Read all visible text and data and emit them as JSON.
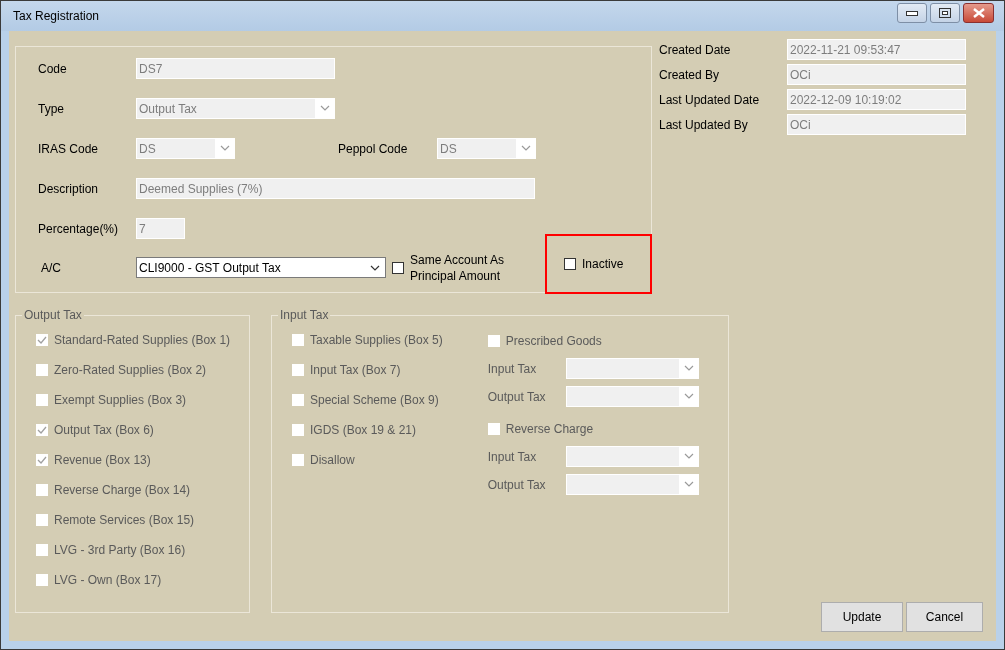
{
  "window": {
    "title": "Tax Registration"
  },
  "main_form": {
    "code": {
      "label": "Code",
      "value": "DS7",
      "disabled": true
    },
    "type": {
      "label": "Type",
      "value": "Output Tax",
      "disabled": true
    },
    "iras_code": {
      "label": "IRAS Code",
      "value": "DS",
      "disabled": true
    },
    "peppol_code": {
      "label": "Peppol Code",
      "value": "DS",
      "disabled": true
    },
    "description": {
      "label": "Description",
      "value": "Deemed Supplies (7%)",
      "disabled": true
    },
    "percentage": {
      "label": "Percentage(%)",
      "value": "7",
      "disabled": true
    },
    "account": {
      "label": "A/C",
      "value": "CLI9000 - GST Output Tax",
      "disabled": false
    },
    "same_account": {
      "label": "Same Account As Principal Amount",
      "checked": false,
      "disabled": false
    },
    "inactive": {
      "label": "Inactive",
      "checked": false,
      "disabled": false,
      "highlighted": true
    }
  },
  "audit": [
    {
      "label": "Created Date",
      "value": "2022-11-21 09:53:47"
    },
    {
      "label": "Created By",
      "value": "OCi"
    },
    {
      "label": "Last Updated Date",
      "value": "2022-12-09 10:19:02"
    },
    {
      "label": "Last Updated By",
      "value": "OCi"
    }
  ],
  "output_tax": {
    "title": "Output Tax",
    "items": [
      {
        "label": "Standard-Rated Supplies (Box 1)",
        "checked": true,
        "disabled": true
      },
      {
        "label": "Zero-Rated Supplies (Box 2)",
        "checked": false,
        "disabled": true
      },
      {
        "label": "Exempt Supplies (Box 3)",
        "checked": false,
        "disabled": true
      },
      {
        "label": "Output Tax (Box 6)",
        "checked": true,
        "disabled": true
      },
      {
        "label": "Revenue (Box 13)",
        "checked": true,
        "disabled": true
      },
      {
        "label": "Reverse Charge (Box 14)",
        "checked": false,
        "disabled": true
      },
      {
        "label": "Remote Services (Box 15)",
        "checked": false,
        "disabled": true
      },
      {
        "label": "LVG - 3rd Party (Box 16)",
        "checked": false,
        "disabled": true
      },
      {
        "label": "LVG - Own (Box 17)",
        "checked": false,
        "disabled": true
      }
    ]
  },
  "input_tax": {
    "title": "Input Tax",
    "items": [
      {
        "label": "Taxable Supplies (Box 5)",
        "checked": false,
        "disabled": true
      },
      {
        "label": "Input Tax (Box 7)",
        "checked": false,
        "disabled": true
      },
      {
        "label": "Special Scheme (Box 9)",
        "checked": false,
        "disabled": true
      },
      {
        "label": "IGDS (Box 19 & 21)",
        "checked": false,
        "disabled": true
      },
      {
        "label": "Disallow",
        "checked": false,
        "disabled": true
      }
    ],
    "special": [
      {
        "label": "Prescribed Goods",
        "checked": false,
        "disabled": true,
        "selects": [
          {
            "label": "Input Tax",
            "disabled": true
          },
          {
            "label": "Output Tax",
            "disabled": true
          }
        ]
      },
      {
        "label": "Reverse Charge",
        "checked": false,
        "disabled": true,
        "selects": [
          {
            "label": "Input Tax",
            "disabled": true
          },
          {
            "label": "Output Tax",
            "disabled": true
          }
        ]
      }
    ]
  },
  "buttons": [
    {
      "label": "Update"
    },
    {
      "label": "Cancel"
    }
  ]
}
